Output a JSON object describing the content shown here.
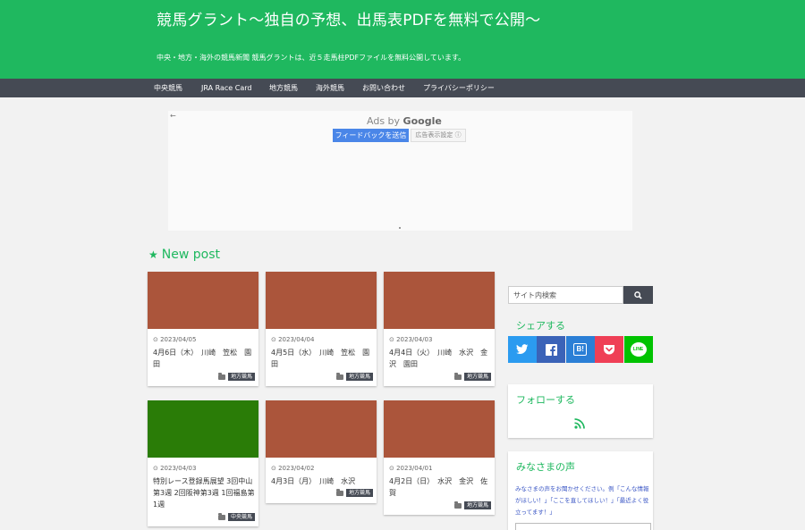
{
  "header": {
    "title": "競馬グラント〜独自の予想、出馬表PDFを無料で公開〜",
    "description": "中央・地方・海外の競馬新聞 競馬グラントは、近５走馬柱PDFファイルを無料公開しています。"
  },
  "nav": {
    "items": [
      "中央競馬",
      "JRA Race Card",
      "地方競馬",
      "海外競馬",
      "お問い合わせ",
      "プライバシーポリシー"
    ]
  },
  "ad": {
    "back": "←",
    "ads_by": "Ads by",
    "google": "Google",
    "feedback": "フィードバックを送信",
    "settings": "広告表示設定 ⓘ"
  },
  "section": {
    "title": "New post"
  },
  "cards": [
    {
      "date": "2023/04/05",
      "title": "4月6日（木）　川崎　笠松　園田",
      "category": "地方競馬",
      "thumb": "#ab553b"
    },
    {
      "date": "2023/04/04",
      "title": "4月5日（水）　川崎　笠松　園田",
      "category": "地方競馬",
      "thumb": "#ab553b"
    },
    {
      "date": "2023/04/03",
      "title": "4月4日（火）　川崎　水沢　金沢　園田",
      "category": "地方競馬",
      "thumb": "#ab553b"
    },
    {
      "date": "2023/04/03",
      "title": "特別レース登録馬展望 3回中山第3週 2回阪神第3週 1回福島第1週",
      "category": "中央競馬",
      "thumb": "#2a7c07"
    },
    {
      "date": "2023/04/02",
      "title": "4月3日（月）　川崎　水沢",
      "category": "地方競馬",
      "thumb": "#ab553b"
    },
    {
      "date": "2023/04/01",
      "title": "4月2日（日）　水沢　金沢　佐賀",
      "category": "地方競馬",
      "thumb": "#ab553b"
    }
  ],
  "sidebar": {
    "search_placeholder": "サイト内検索",
    "share_title": "シェアする",
    "share_buttons": [
      {
        "icon": "twitter-icon",
        "color": "#2b9bf0"
      },
      {
        "icon": "facebook-icon",
        "color": "#3b63b8"
      },
      {
        "icon": "hatena-icon",
        "color": "#2b7fd6"
      },
      {
        "icon": "pocket-icon",
        "color": "#ef3f56",
        "label": ""
      },
      {
        "icon": "line-icon",
        "color": "#00c300",
        "label": "LINE"
      }
    ],
    "hatena_label": "B!",
    "follow_title": "フォローする",
    "voice_title": "みなさまの声",
    "voice_text": "みなさまの声をお聞かせください。例「こんな情報がほしい！」「ここを直してほしい！」「最近よく役立ってます！」"
  },
  "colors": {
    "brand": "#1fb85f",
    "nav": "#454a54",
    "thumb_default": "#ab553b"
  }
}
